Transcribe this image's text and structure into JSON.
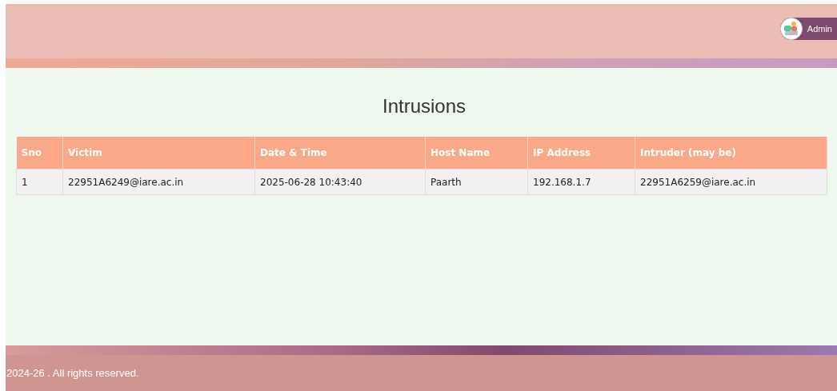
{
  "header": {
    "user": {
      "name": "Admin"
    }
  },
  "page": {
    "title": "Intrusions"
  },
  "table": {
    "columns": [
      "Sno",
      "Victim",
      "Date & Time",
      "Host Name",
      "IP Address",
      "Intruder (may be)"
    ],
    "rows": [
      [
        "1",
        "22951A6249@iare.ac.in",
        "2025-06-28 10:43:40",
        "Paarth",
        "192.168.1.7",
        "22951A6259@iare.ac.in"
      ]
    ]
  },
  "footer": {
    "text": "2024-26 . All rights reserved."
  }
}
